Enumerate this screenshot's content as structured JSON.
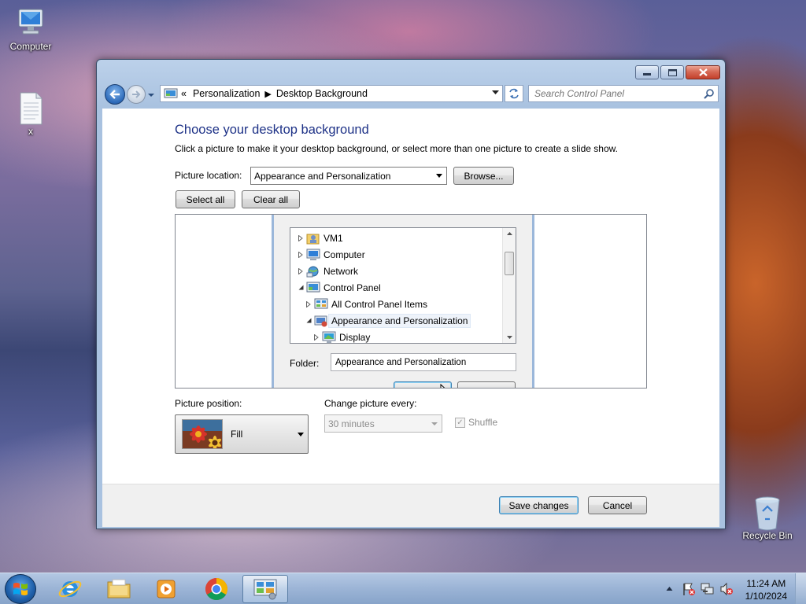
{
  "desktop": {
    "icons": [
      {
        "label": "Computer"
      },
      {
        "label": "x"
      },
      {
        "label": "Recycle Bin"
      }
    ]
  },
  "window": {
    "address": {
      "overflow": "«",
      "crumbs": [
        "Personalization",
        "Desktop Background"
      ]
    },
    "search_placeholder": "Search Control Panel"
  },
  "page": {
    "title": "Choose your desktop background",
    "description": "Click a picture to make it your desktop background, or select more than one picture to create a slide show.",
    "picture_location_label": "Picture location:",
    "picture_location_value": "Appearance and Personalization",
    "browse_label": "Browse...",
    "select_all_label": "Select all",
    "clear_all_label": "Clear all",
    "picture_position_label": "Picture position:",
    "picture_position_value": "Fill",
    "change_every_label": "Change picture every:",
    "change_every_value": "30 minutes",
    "shuffle_label": "Shuffle",
    "shuffle_checked": true,
    "save_label": "Save changes",
    "cancel_label": "Cancel"
  },
  "browse_dialog": {
    "tree": [
      {
        "label": "VM1",
        "expanded": false,
        "icon": "user-folder-icon"
      },
      {
        "label": "Computer",
        "expanded": false,
        "icon": "computer-icon"
      },
      {
        "label": "Network",
        "expanded": false,
        "icon": "network-icon"
      },
      {
        "label": "Control Panel",
        "expanded": true,
        "icon": "control-panel-icon"
      },
      {
        "label": "All Control Panel Items",
        "expanded": false,
        "icon": "control-panel-items-icon"
      },
      {
        "label": "Appearance and Personalization",
        "expanded": true,
        "selected": true,
        "icon": "appearance-icon"
      },
      {
        "label": "Display",
        "expanded": false,
        "icon": "display-icon"
      }
    ],
    "folder_label": "Folder:",
    "folder_value": "Appearance and Personalization"
  },
  "taskbar": {
    "pinned": [
      "internet-explorer-icon",
      "file-explorer-icon",
      "media-player-icon",
      "chrome-icon",
      "control-panel-icon"
    ],
    "clock": {
      "time": "11:24 AM",
      "date": "1/10/2024"
    }
  },
  "colors": {
    "title_blue": "#1e3287",
    "window_frame": "#a9c2e0",
    "close_red": "#c4402b"
  }
}
